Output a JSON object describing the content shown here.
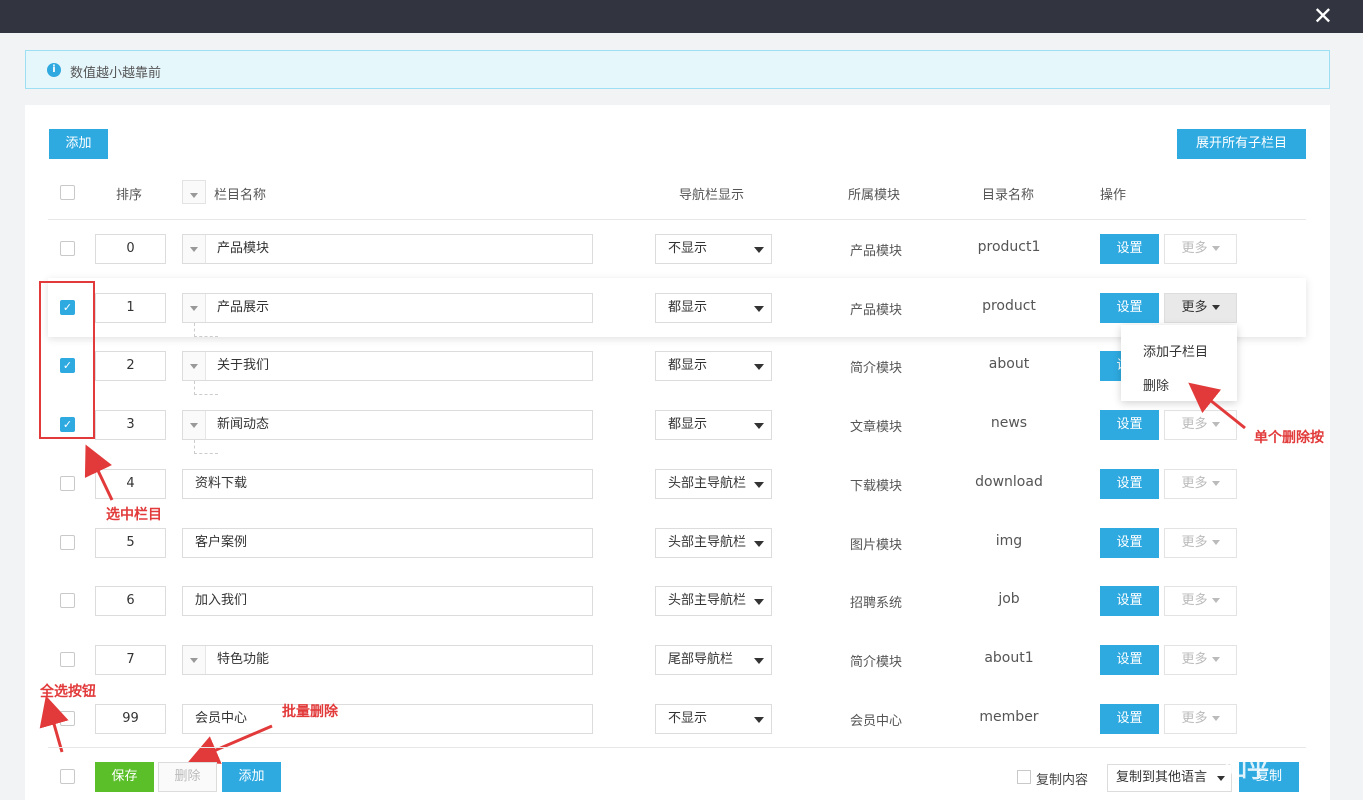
{
  "dialog": {
    "close_symbol": "✕"
  },
  "alert": {
    "icon": "info-icon",
    "icon_glyph": "i",
    "text": "数值越小越靠前"
  },
  "toolbar": {
    "add_label": "添加",
    "expand_all_label": "展开所有子栏目"
  },
  "table": {
    "headers": {
      "sort": "排序",
      "name": "栏目名称",
      "nav": "导航栏显示",
      "module": "所属模块",
      "dir": "目录名称",
      "ops": "操作"
    },
    "set_label": "设置",
    "more_label": "更多",
    "rows": [
      {
        "checked": false,
        "sort": "0",
        "name": "产品模块",
        "has_children": true,
        "nav": "不显示",
        "module": "产品模块",
        "dir": "product1"
      },
      {
        "checked": true,
        "sort": "1",
        "name": "产品展示",
        "has_children": true,
        "nav": "都显示",
        "module": "产品模块",
        "dir": "product"
      },
      {
        "checked": true,
        "sort": "2",
        "name": "关于我们",
        "has_children": true,
        "nav": "都显示",
        "module": "简介模块",
        "dir": "about"
      },
      {
        "checked": true,
        "sort": "3",
        "name": "新闻动态",
        "has_children": true,
        "nav": "都显示",
        "module": "文章模块",
        "dir": "news"
      },
      {
        "checked": false,
        "sort": "4",
        "name": "资料下载",
        "has_children": false,
        "nav": "头部主导航栏",
        "module": "下载模块",
        "dir": "download"
      },
      {
        "checked": false,
        "sort": "5",
        "name": "客户案例",
        "has_children": false,
        "nav": "头部主导航栏",
        "module": "图片模块",
        "dir": "img"
      },
      {
        "checked": false,
        "sort": "6",
        "name": "加入我们",
        "has_children": false,
        "nav": "头部主导航栏",
        "module": "招聘系统",
        "dir": "job"
      },
      {
        "checked": false,
        "sort": "7",
        "name": "特色功能",
        "has_children": true,
        "nav": "尾部导航栏",
        "module": "简介模块",
        "dir": "about1"
      },
      {
        "checked": false,
        "sort": "99",
        "name": "会员中心",
        "has_children": false,
        "nav": "不显示",
        "module": "会员中心",
        "dir": "member"
      }
    ]
  },
  "more_menu": {
    "add_child": "添加子栏目",
    "delete": "删除"
  },
  "footer": {
    "save_label": "保存",
    "delete_label": "删除",
    "add_label": "添加",
    "copy_content_label": "复制内容",
    "copy_to_lang_value": "复制到其他语言",
    "copy_label": "复制"
  },
  "annotations": {
    "select_columns": "选中栏目",
    "single_delete": "单个删除按",
    "select_all": "全选按钮",
    "batch_delete": "批量删除",
    "color": "#e23a3a"
  },
  "watermark": "知乎"
}
